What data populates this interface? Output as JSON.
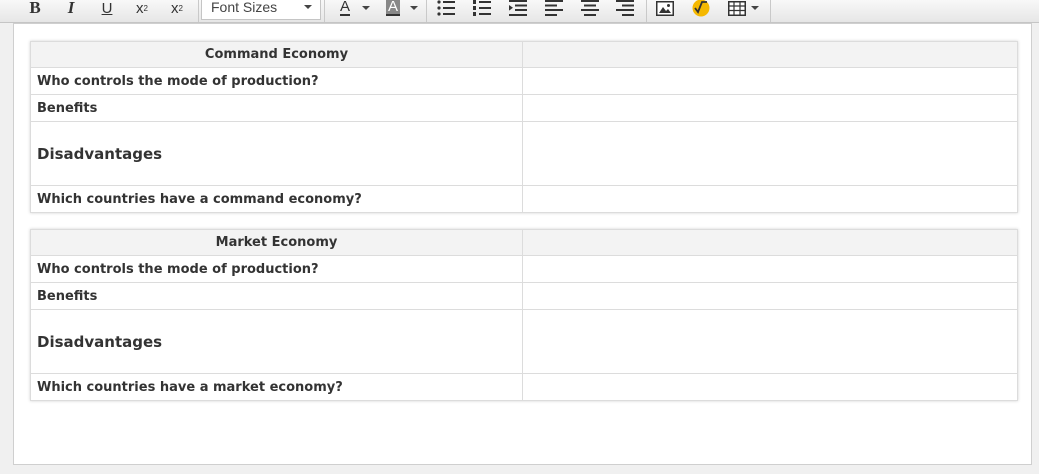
{
  "toolbar": {
    "font_sizes_label": "Font Sizes"
  },
  "tables": [
    {
      "title": "Command Economy",
      "rows": [
        {
          "label": "Who controls the mode of production?",
          "value": ""
        },
        {
          "label": "Benefits",
          "value": ""
        },
        {
          "label": "Disadvantages",
          "value": ""
        },
        {
          "label": "Which countries have a command economy?",
          "value": ""
        }
      ]
    },
    {
      "title": "Market Economy",
      "rows": [
        {
          "label": "Who controls the mode of production?",
          "value": ""
        },
        {
          "label": "Benefits",
          "value": ""
        },
        {
          "label": "Disadvantages",
          "value": ""
        },
        {
          "label": "Which countries have a market economy?",
          "value": ""
        }
      ]
    }
  ]
}
